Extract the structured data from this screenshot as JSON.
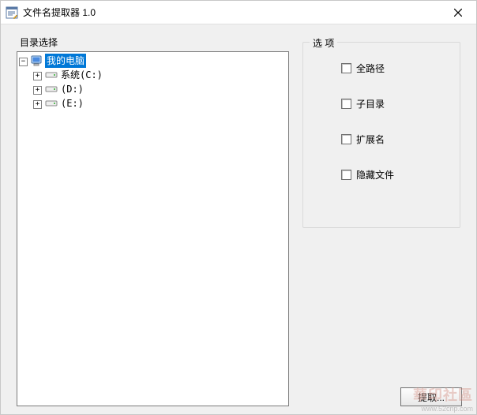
{
  "window": {
    "title": "文件名提取器 1.0"
  },
  "tree": {
    "legend": "目录选择",
    "root": {
      "label": "我的电脑",
      "expanded": true,
      "selected": true,
      "children": [
        {
          "label": "系统(C:)",
          "expanded": false
        },
        {
          "label": "(D:)",
          "expanded": false
        },
        {
          "label": "(E:)",
          "expanded": false
        }
      ]
    }
  },
  "options": {
    "legend": "选 项",
    "items": [
      {
        "label": "全路径",
        "checked": false
      },
      {
        "label": "子目录",
        "checked": false
      },
      {
        "label": "扩展名",
        "checked": false
      },
      {
        "label": "隐藏文件",
        "checked": false
      }
    ]
  },
  "actions": {
    "extract_label": "提取..."
  },
  "watermark": {
    "main": "華印社區",
    "sub": "www.52cnp.com"
  }
}
